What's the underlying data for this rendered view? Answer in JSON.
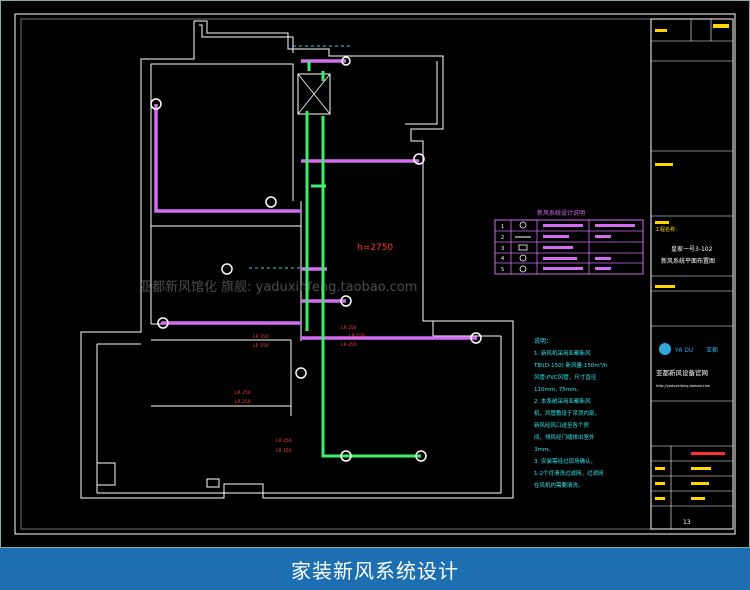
{
  "drawing": {
    "height_tag": "h=2750",
    "watermark": "亚都新风馆化 旗舰: yaduxinfeng.taobao.com",
    "dim_labels": [
      "LR 250",
      "LR 250",
      "LR 150",
      "LR 150",
      "LR 250",
      "LR 250",
      "LR 250",
      "LR 150",
      "LR 150"
    ]
  },
  "legend_table": {
    "title": "新风系统设计说明",
    "row_nums": [
      "1",
      "2",
      "3",
      "4",
      "5"
    ]
  },
  "notes": {
    "title": "说明：",
    "lines": [
      "1. 新风机采用亚都新风",
      "TBI(D-150) 新风量:150m³/h",
      "风管:PVC风管，尺寸直径",
      "110mm, 75mm。",
      "2. 本系统采用亚都新风",
      "机，风管敷设于吊顶内部，",
      "新风经风口送至各个房",
      "间，排风经门缝排出室外",
      "3mm。",
      "3. 安装需经过现场确认，",
      "1-2个月清洗过滤网，过滤网",
      "在风机内需要清洗。"
    ]
  },
  "title_block": {
    "project_label": "工程名称：",
    "project_name": "皇家一号3-102",
    "drawing_name": "新风系统平面布置图",
    "brand_initials": "YA  DU",
    "brand_name": "亚都",
    "company": "亚都新风设备官网",
    "url": "http://yaduxinfeng.taobao.com",
    "sheet_no": "13"
  },
  "caption": "家装新风系统设计"
}
